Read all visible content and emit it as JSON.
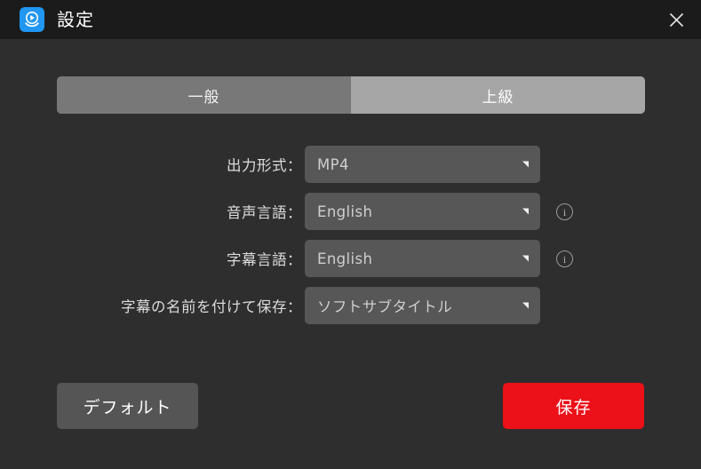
{
  "window": {
    "title": "設定",
    "app_icon": "play-logo-icon",
    "close_icon": "close-icon",
    "colors": {
      "titlebar_bg": "#1b1b1b",
      "body_bg": "#2e2e2e",
      "tab_inactive": "#787878",
      "tab_active": "#a6a6a6",
      "select_bg": "#575757",
      "accent_red": "#ec1018",
      "default_btn": "#555555"
    }
  },
  "tabs": [
    {
      "label": "一般",
      "active": false,
      "name": "tab-general"
    },
    {
      "label": "上級",
      "active": true,
      "name": "tab-advanced"
    }
  ],
  "form": {
    "rows": [
      {
        "label": "出力形式：",
        "value": "MP4",
        "has_info": false,
        "name": "output-format"
      },
      {
        "label": "音声言語：",
        "value": "English",
        "has_info": true,
        "name": "audio-language"
      },
      {
        "label": "字幕言語：",
        "value": "English",
        "has_info": true,
        "name": "subtitle-language"
      },
      {
        "label": "字幕の名前を付けて保存：",
        "value": "ソフトサブタイトル",
        "has_info": false,
        "name": "subtitle-save-as"
      }
    ]
  },
  "footer": {
    "default_label": "デフォルト",
    "save_label": "保存"
  },
  "icons": {
    "info": "i"
  }
}
